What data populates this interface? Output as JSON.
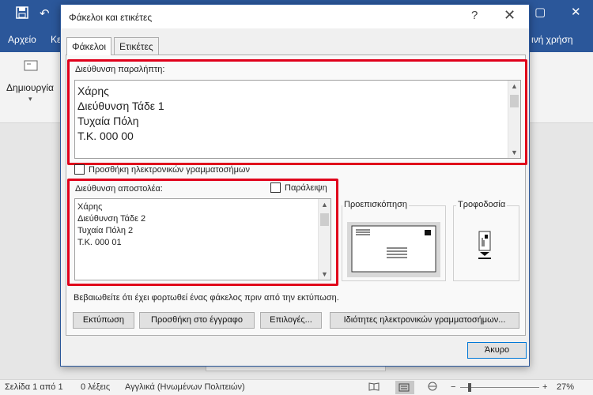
{
  "word": {
    "ribbon_tab_file": "Αρχείο",
    "ribbon_tab_partial": "Κε",
    "ribbon_tab_right": "ινή χρήση",
    "create_label": "Δημιουργία"
  },
  "status": {
    "page": "Σελίδα 1 από 1",
    "words": "0 λέξεις",
    "language": "Αγγλικά (Ηνωμένων Πολιτειών)",
    "zoom": "27%"
  },
  "dialog": {
    "title": "Φάκελοι και ετικέτες",
    "help": "?",
    "close": "✕",
    "tabs": [
      {
        "label": "Φάκελοι",
        "active": true
      },
      {
        "label": "Ετικέτες",
        "active": false
      }
    ],
    "recipient": {
      "label": "Διεύθυνση παραλήπτη:",
      "lines": [
        "Χάρης",
        "Διεύθυνση Τάδε 1",
        "Τυχαία Πόλη",
        "Τ.Κ. 000 00"
      ]
    },
    "add_postage": "Προσθήκη ηλεκτρονικών γραμματοσήμων",
    "sender": {
      "label": "Διεύθυνση αποστολέα:",
      "omit": "Παράλειψη",
      "lines": [
        "Χάρης",
        "Διεύθυνση Τάδε 2",
        "Τυχαία Πόλη 2",
        "Τ.Κ. 000 01"
      ]
    },
    "preview_title": "Προεπισκόπηση",
    "feed_title": "Τροφοδοσία",
    "note": "Βεβαιωθείτε ότι έχει φορτωθεί ένας φάκελος πριν από την εκτύπωση.",
    "buttons": {
      "print": "Εκτύπωση",
      "add_to_doc": "Προσθήκη στο έγγραφο",
      "options": "Επιλογές...",
      "postage_props": "Ιδιότητες ηλεκτρονικών γραμματοσήμων...",
      "cancel": "Άκυρο"
    }
  },
  "colors": {
    "word_blue": "#2b579a",
    "highlight_red": "#e0001b"
  }
}
